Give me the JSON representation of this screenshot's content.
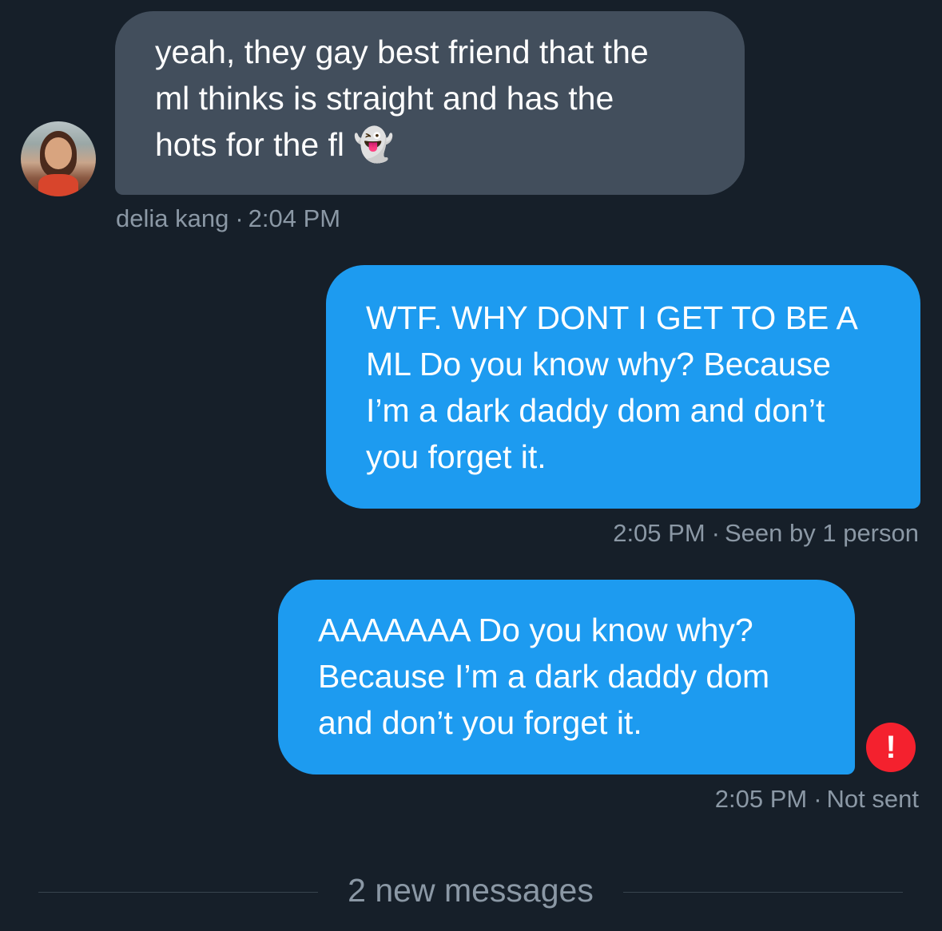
{
  "messages": [
    {
      "direction": "incoming",
      "text": "yeah, they gay best friend that the\nml thinks is straight and has the\nhots for the fl 👻",
      "sender": "delia kang",
      "time": "2:04 PM"
    },
    {
      "direction": "outgoing",
      "text": "WTF. WHY DONT I GET TO BE A\nML Do you know why? Because\nI’m a dark daddy dom and don’t\nyou forget it.",
      "time": "2:05 PM",
      "status": "Seen by 1 person"
    },
    {
      "direction": "outgoing",
      "text": "AAAAAAA Do you know why?\nBecause I’m a dark daddy dom\nand don’t you forget it.",
      "time": "2:05 PM",
      "status": "Not sent",
      "error_icon": "!"
    }
  ],
  "separator": "·",
  "new_messages_label": "2 new messages",
  "colors": {
    "background": "#161f29",
    "incoming_bubble": "#424e5c",
    "outgoing_bubble": "#1d9bf0",
    "meta_text": "#8b98a5",
    "error": "#f4212e"
  }
}
